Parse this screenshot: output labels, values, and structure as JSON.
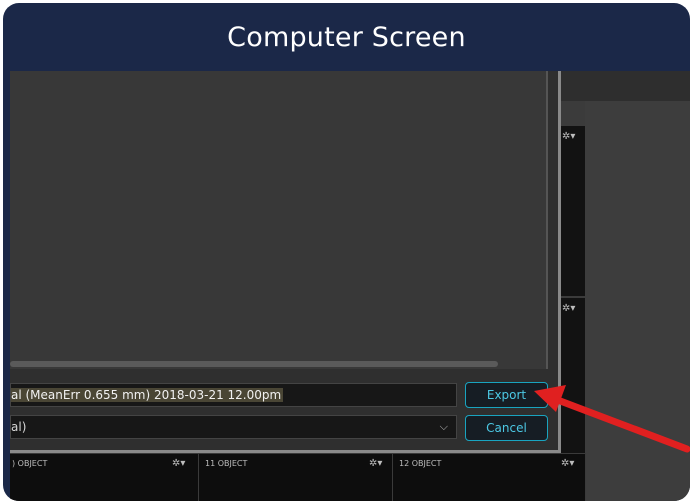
{
  "frame": {
    "title": "Computer Screen"
  },
  "dialog": {
    "name_value_prefix": "al (MeanErr 0.655 mm) 2018-03-21 12.00pm",
    "select_value": "al)",
    "export_label": "Export",
    "cancel_label": "Cancel"
  },
  "bottom_row": {
    "cells": [
      {
        "label": ") OBJECT"
      },
      {
        "label": "11 OBJECT"
      },
      {
        "label": "12 OBJECT"
      }
    ]
  },
  "icons": {
    "gear": "gear-dropdown-icon",
    "chevron": "chevron-down-icon",
    "arrow": "red-arrow-annotation"
  },
  "colors": {
    "frame": "#1b2848",
    "button_border": "#19a4c0",
    "button_text": "#4cc8e4",
    "arrow": "#e02020"
  }
}
